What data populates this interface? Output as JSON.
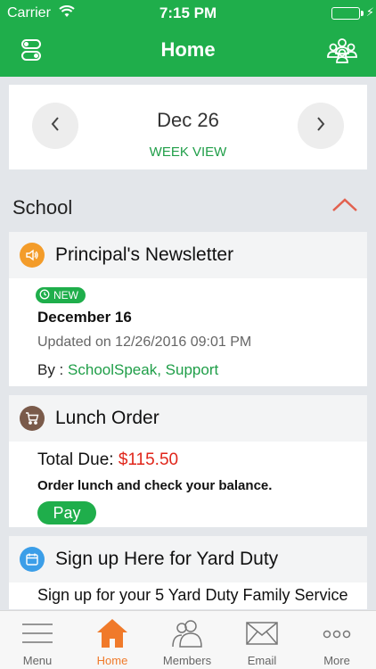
{
  "status": {
    "carrier": "Carrier",
    "time": "7:15 PM",
    "icons": [
      "wifi-icon",
      "battery-icon",
      "charging-icon"
    ]
  },
  "nav": {
    "title": "Home",
    "left_icon": "toggles-icon",
    "right_icon": "group-icon"
  },
  "date_picker": {
    "date": "Dec 26",
    "mode": "WEEK VIEW",
    "prev_icon": "chevron-left-icon",
    "next_icon": "chevron-right-icon"
  },
  "section": {
    "label": "School",
    "toggle_icon": "chevron-up-icon"
  },
  "cards": {
    "newsletter": {
      "title": "Principal's Newsletter",
      "icon": "speaker-icon",
      "icon_color": "#f39c2a",
      "badge": "NEW",
      "heading": "December 16",
      "updated": "Updated on 12/26/2016 09:01 PM",
      "by_label": "By :",
      "author": "SchoolSpeak, Support"
    },
    "lunch": {
      "title": "Lunch Order",
      "icon": "cart-icon",
      "icon_color": "#7a5a4a",
      "due_label": "Total Due:",
      "due_amount": "$115.50",
      "description": "Order lunch and check your balance.",
      "pay_label": "Pay"
    },
    "yard_duty": {
      "title": "Sign up Here for Yard Duty",
      "icon": "calendar-icon",
      "icon_color": "#3b9ee8",
      "text": "Sign up for your 5 Yard Duty Family Service"
    }
  },
  "tabs": [
    {
      "label": "Menu",
      "icon": "hamburger-icon",
      "active": false
    },
    {
      "label": "Home",
      "icon": "house-icon",
      "active": true
    },
    {
      "label": "Members",
      "icon": "members-icon",
      "active": false
    },
    {
      "label": "Email",
      "icon": "envelope-icon",
      "active": false
    },
    {
      "label": "More",
      "icon": "ellipsis-icon",
      "active": false
    }
  ],
  "colors": {
    "brand_green": "#1fae4b",
    "accent_orange": "#f07a2a",
    "amount_red": "#e0261b"
  }
}
